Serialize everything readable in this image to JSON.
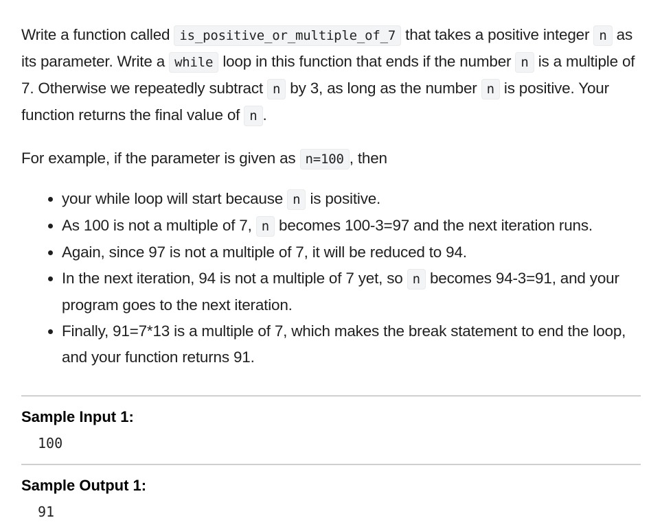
{
  "intro": {
    "t1": "Write a function called ",
    "c1": "is_positive_or_multiple_of_7",
    "t2": " that takes a positive integer ",
    "c2": "n",
    "t3": " as its parameter. Write a ",
    "c3": "while",
    "t4": " loop in this function that ends if the number ",
    "c4": "n",
    "t5": " is a multiple of 7. Otherwise we repeatedly subtract ",
    "c5": "n",
    "t6": " by 3, as long as the number ",
    "c6": "n",
    "t7": " is positive. Your function returns the final value of ",
    "c7": "n",
    "t8": "."
  },
  "example": {
    "t1": "For example, if the parameter is given as ",
    "c1": "n=100",
    "t2": ", then"
  },
  "bullets": [
    {
      "a": "your while loop will start because ",
      "code": "n",
      "b": " is positive."
    },
    {
      "a": "As 100 is not a multiple of 7, ",
      "code": "n",
      "b": " becomes 100-3=97 and the next iteration runs."
    },
    {
      "a": "Again, since 97 is not a multiple of 7, it will be reduced to 94.",
      "code": null,
      "b": ""
    },
    {
      "a": "In the next iteration, 94 is not a multiple of 7 yet, so ",
      "code": "n",
      "b": " becomes 94-3=91, and your program goes to the next iteration."
    },
    {
      "a": "Finally, 91=7*13 is a multiple of 7, which makes the break statement to end the loop, and your function returns 91.",
      "code": null,
      "b": ""
    }
  ],
  "samples": {
    "input_title": "Sample Input 1:",
    "input_value": "100",
    "output_title": "Sample Output 1:",
    "output_value": "91"
  }
}
